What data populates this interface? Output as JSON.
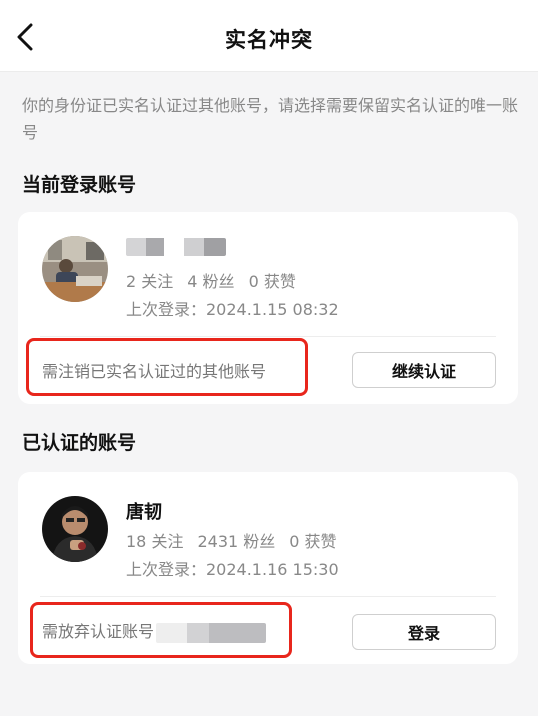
{
  "nav": {
    "title": "实名冲突",
    "back_icon": "chevron-left-icon"
  },
  "notice": "你的身份证已实名认证过其他账号，请选择需要保留实名认证的唯一账号",
  "current_section": {
    "title": "当前登录账号",
    "account": {
      "name": "",
      "stats": [
        "2 关注",
        "4 粉丝",
        "0 获赞"
      ],
      "last_login": "上次登录：2024.1.15 08:32"
    },
    "hint": "需注销已实名认证过的其他账号",
    "button_label": "继续认证"
  },
  "verified_section": {
    "title": "已认证的账号",
    "account": {
      "name": "唐韧",
      "stats": [
        "18 关注",
        "2431 粉丝",
        "0 获赞"
      ],
      "last_login": "上次登录：2024.1.16 15:30"
    },
    "hint": "需放弃认证账号",
    "button_label": "登录"
  },
  "colors": {
    "highlight": "#e8261c",
    "muted_text": "#888888",
    "background": "#f5f5f6"
  }
}
